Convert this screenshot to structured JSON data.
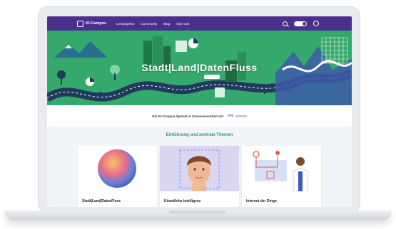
{
  "nav": {
    "logo": "KI-Campus",
    "links": [
      "Lernangebot",
      "Community",
      "Blog",
      "Über uns"
    ],
    "colors": {
      "bar": "#4b2f8c"
    }
  },
  "hero": {
    "title": "Stadt|Land|DatenFluss",
    "colors": {
      "bg": "#34a96b"
    }
  },
  "partner": {
    "text": "Ein KI-Campus-Spezial in Zusammenarbeit mit",
    "logo": "vhs"
  },
  "section": {
    "title": "Einführung und zentrale Themen",
    "cards": [
      {
        "label": "Stadt|Land|DatenFluss"
      },
      {
        "label": "Künstliche Intelligenz"
      },
      {
        "label": "Internet der Dinge"
      }
    ]
  }
}
